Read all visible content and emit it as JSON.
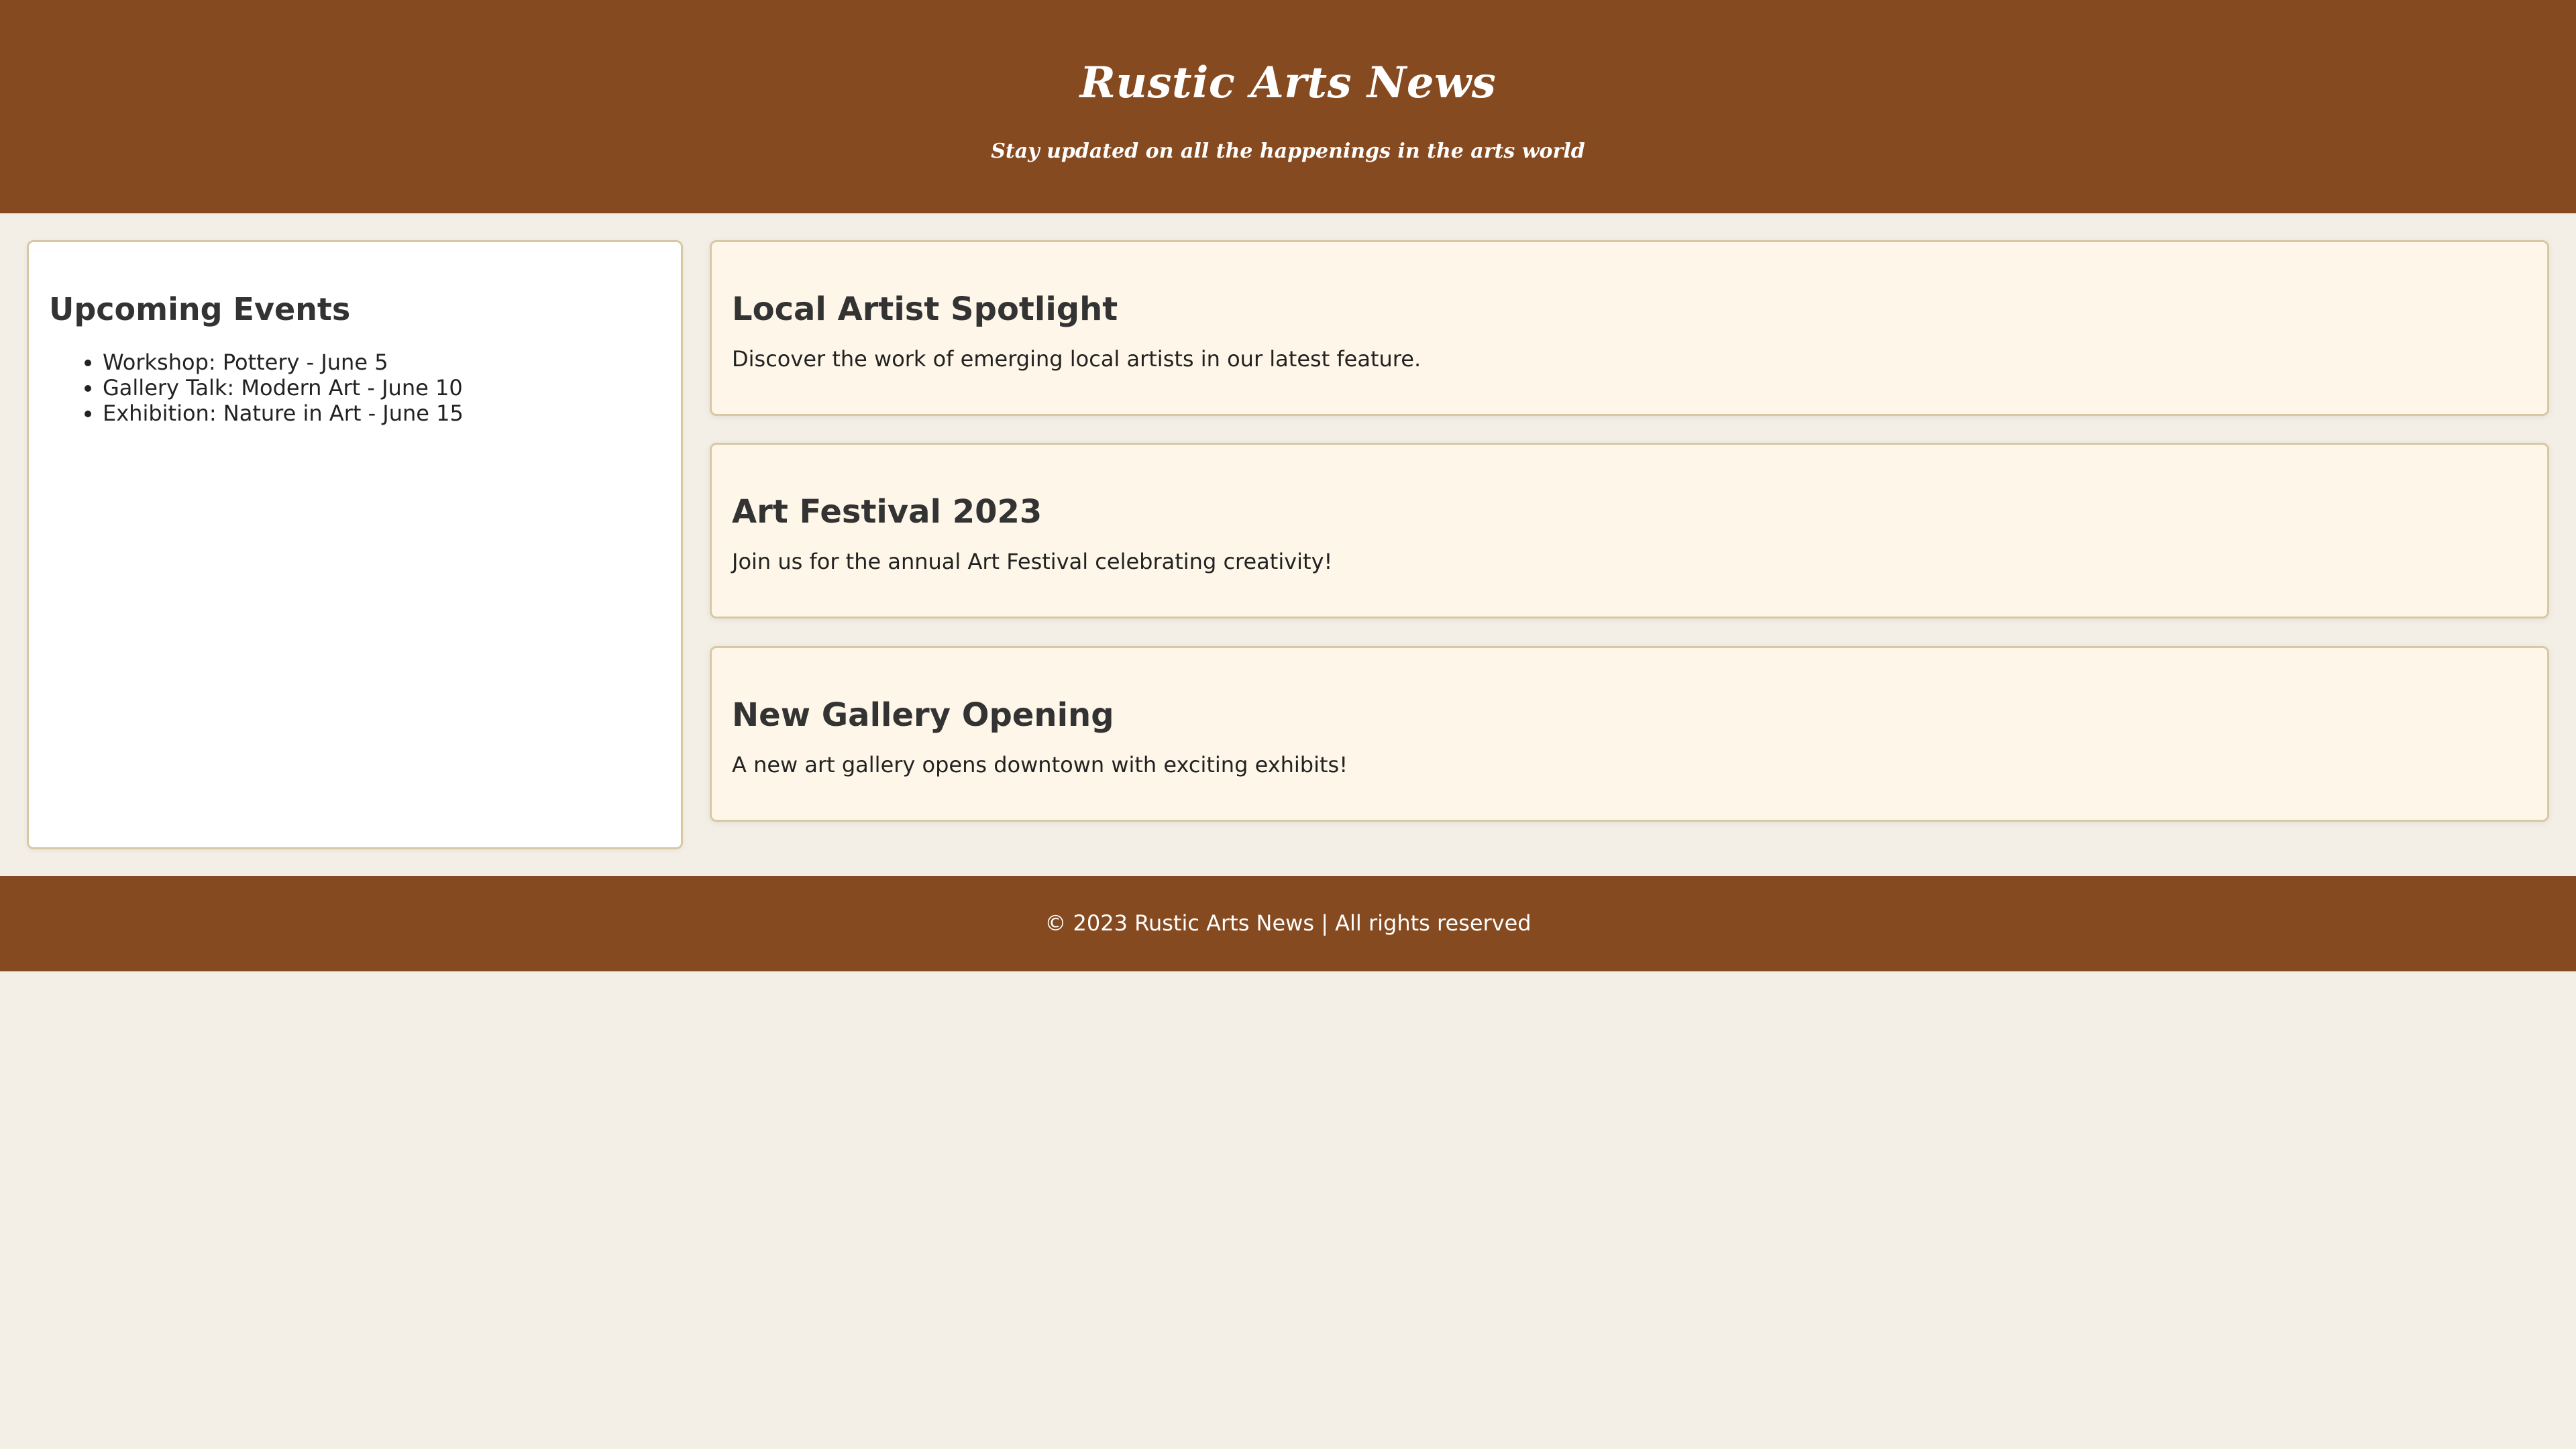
{
  "header": {
    "title": "Rustic Arts News",
    "tagline": "Stay updated on all the happenings in the arts world"
  },
  "sidebar": {
    "title": "Upcoming Events",
    "events": [
      "Workshop: Pottery - June 5",
      "Gallery Talk: Modern Art - June 10",
      "Exhibition: Nature in Art - June 15"
    ]
  },
  "articles": [
    {
      "title": "Local Artist Spotlight",
      "body": "Discover the work of emerging local artists in our latest feature."
    },
    {
      "title": "Art Festival 2023",
      "body": "Join us for the annual Art Festival celebrating creativity!"
    },
    {
      "title": "New Gallery Opening",
      "body": "A new art gallery opens downtown with exciting exhibits!"
    }
  ],
  "footer": {
    "text": "© 2023 Rustic Arts News | All rights reserved"
  },
  "colors": {
    "brand_brown": "#864a21",
    "page_background": "#f3efe6",
    "card_background": "#fef6e8",
    "card_border": "#d8c8a4"
  }
}
